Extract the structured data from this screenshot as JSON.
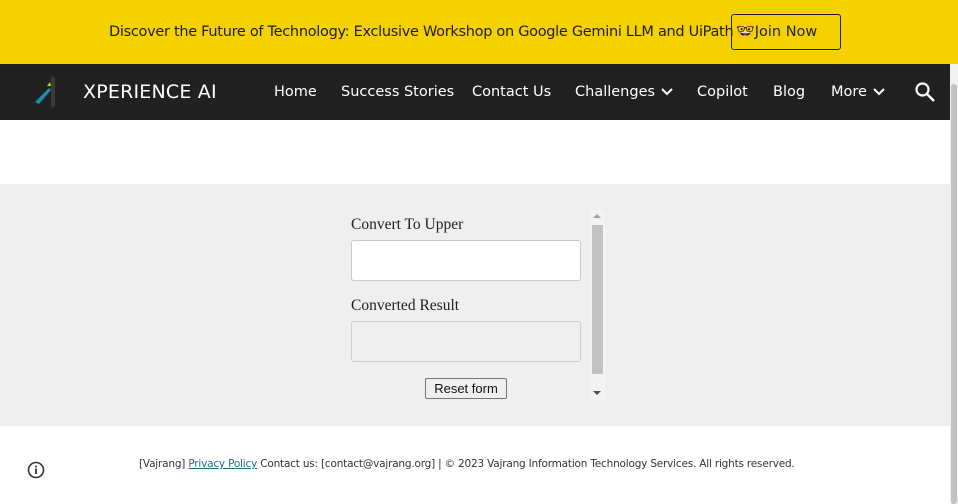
{
  "banner": {
    "text": "Discover the Future of Technology: Exclusive Workshop on Google Gemini LLM and UiPath",
    "emoji": "🤓",
    "join_label": "Join Now",
    "background": "#f6d100"
  },
  "nav": {
    "brand": "XPERIENCE AI",
    "items": [
      {
        "label": "Home"
      },
      {
        "label": "Success Stories"
      },
      {
        "label": "Contact Us"
      },
      {
        "label": "Challenges",
        "dropdown": true
      },
      {
        "label": "Copilot"
      },
      {
        "label": "Blog"
      },
      {
        "label": "More",
        "dropdown": true
      }
    ],
    "background": "#212121",
    "search_icon": "search-icon"
  },
  "form": {
    "input_label": "Convert To Upper",
    "input_value": "",
    "result_label": "Converted Result",
    "result_value": "",
    "reset_label": "Reset form"
  },
  "footer": {
    "prefix": "[Vajrang]",
    "privacy_label": "Privacy Policy",
    "suffix": "Contact us: [contact@vajrang.org] | © 2023 Vajrang Information Technology Services. All rights reserved."
  }
}
